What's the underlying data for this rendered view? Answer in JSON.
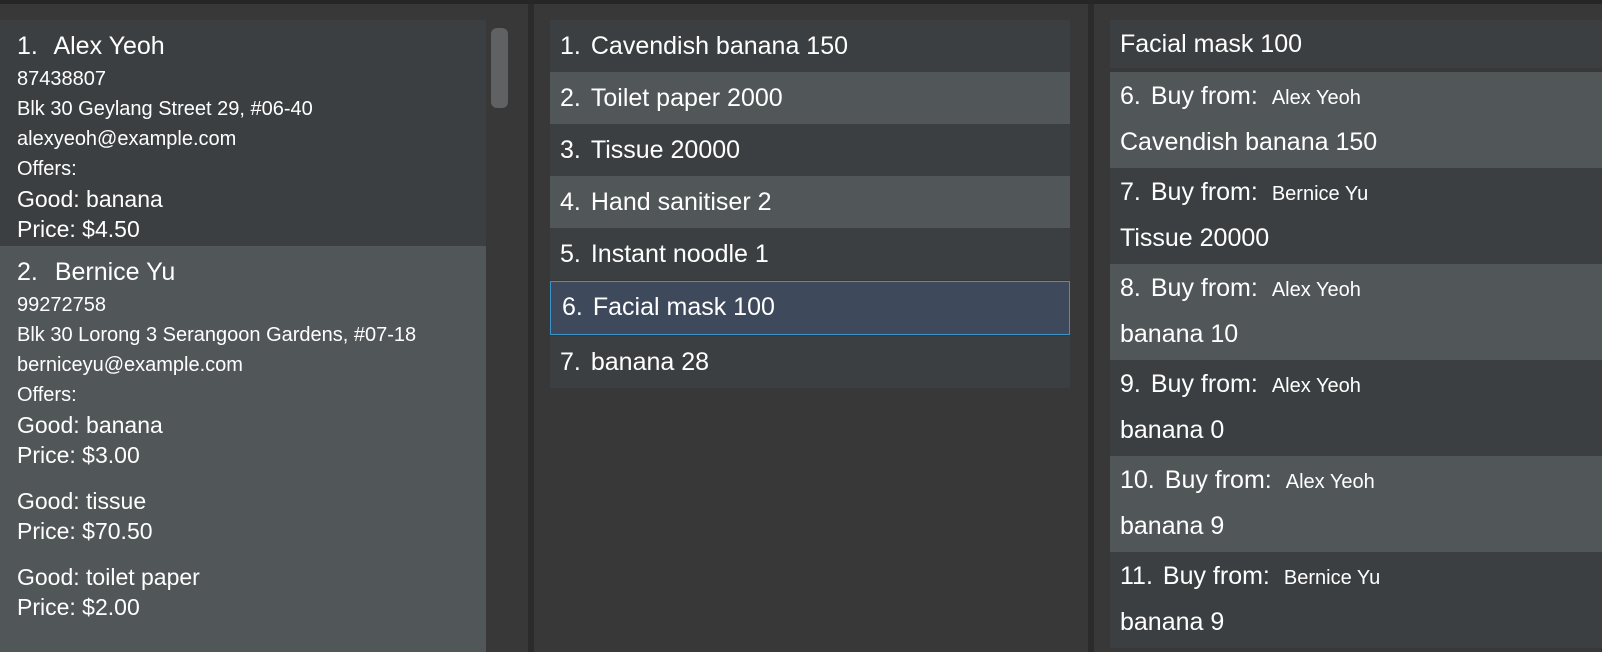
{
  "persons": [
    {
      "index": "1.",
      "name": "Alex Yeoh",
      "phone": "87438807",
      "address": "Blk 30 Geylang Street 29, #06-40",
      "email": "alexyeoh@example.com",
      "offers_label": "Offers:",
      "offers": [
        {
          "good": "Good: banana",
          "price": "Price: $4.50"
        }
      ]
    },
    {
      "index": "2.",
      "name": "Bernice Yu",
      "phone": "99272758",
      "address": "Blk 30 Lorong 3 Serangoon Gardens, #07-18",
      "email": "berniceyu@example.com",
      "offers_label": "Offers:",
      "offers": [
        {
          "good": "Good: banana",
          "price": "Price: $3.00"
        },
        {
          "good": "Good: tissue",
          "price": "Price: $70.50"
        },
        {
          "good": "Good: toilet paper",
          "price": "Price: $2.00"
        }
      ]
    }
  ],
  "goods": [
    {
      "index": "1.",
      "label": "Cavendish banana 150"
    },
    {
      "index": "2.",
      "label": "Toilet paper 2000"
    },
    {
      "index": "3.",
      "label": "Tissue 20000"
    },
    {
      "index": "4.",
      "label": "Hand sanitiser 2"
    },
    {
      "index": "5.",
      "label": "Instant noodle 1"
    },
    {
      "index": "6.",
      "label": "Facial mask 100"
    },
    {
      "index": "7.",
      "label": "banana 28"
    }
  ],
  "goods_selected_index": 5,
  "transactions": {
    "partial_top": "Facial mask 100",
    "buy_label": "Buy from:",
    "items": [
      {
        "index": "6.",
        "seller": "Alex Yeoh",
        "detail": "Cavendish banana 150"
      },
      {
        "index": "7.",
        "seller": "Bernice Yu",
        "detail": "Tissue 20000"
      },
      {
        "index": "8.",
        "seller": "Alex Yeoh",
        "detail": "banana 10"
      },
      {
        "index": "9.",
        "seller": "Alex Yeoh",
        "detail": "banana 0"
      },
      {
        "index": "10.",
        "seller": "Alex Yeoh",
        "detail": "banana 9"
      },
      {
        "index": "11.",
        "seller": "Bernice Yu",
        "detail": "banana 9"
      }
    ]
  }
}
